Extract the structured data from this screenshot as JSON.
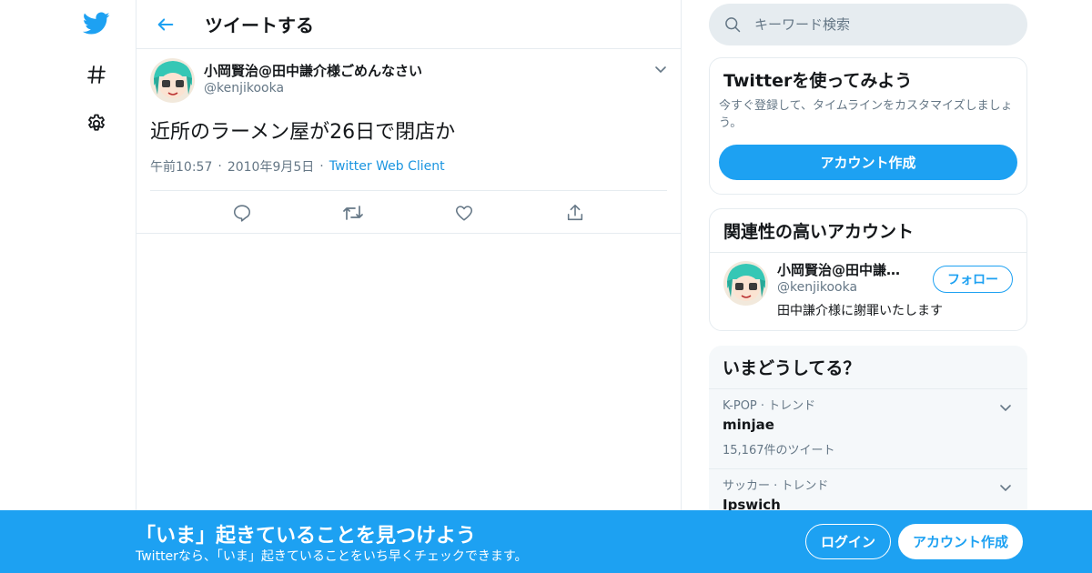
{
  "colors": {
    "accent": "#1da1f2",
    "link": "#1b95e0",
    "muted": "#657786",
    "border": "#e6ecf0"
  },
  "nav": {
    "icons": [
      "twitter-bird-icon",
      "hashtag-icon",
      "gear-icon"
    ]
  },
  "header": {
    "title": "ツイートする"
  },
  "tweet": {
    "display_name": "小岡賢治@田中謙介様ごめんなさい",
    "handle": "@kenjikooka",
    "text": "近所のラーメン屋が26日で閉店か",
    "time": "午前10:57",
    "date": "2010年9月5日",
    "source": "Twitter Web Client"
  },
  "search": {
    "placeholder": "キーワード検索"
  },
  "signup": {
    "title": "Twitterを使ってみよう",
    "desc": "今すぐ登録して、タイムラインをカスタマイズしましょう。",
    "button": "アカウント作成"
  },
  "related": {
    "title": "関連性の高いアカウント",
    "name": "小岡賢治@田中謙…",
    "handle": "@kenjikooka",
    "bio": "田中謙介様に謝罪いたします",
    "follow": "フォロー"
  },
  "trends": {
    "title": "いまどうしてる？",
    "items": [
      {
        "meta": "K-POP · トレンド",
        "name": "minjae",
        "count": "15,167件のツイート"
      },
      {
        "meta": "サッカー · トレンド",
        "name": "Ipswich",
        "count": ""
      }
    ]
  },
  "bottom": {
    "title": "「いま」起きていることを見つけよう",
    "subtitle": "Twitterなら、「いま」起きていることをいち早くチェックできます。",
    "login": "ログイン",
    "signup": "アカウント作成"
  }
}
